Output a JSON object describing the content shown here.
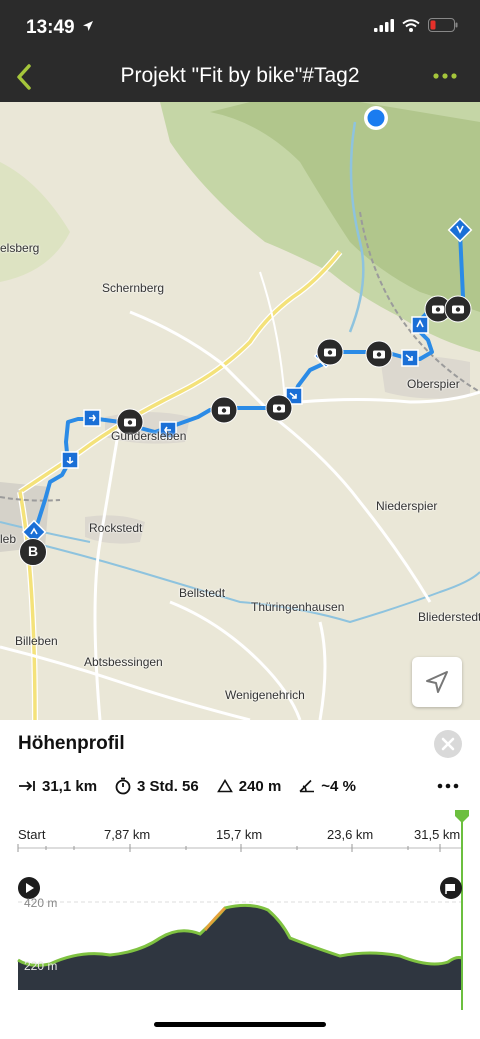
{
  "status": {
    "time": "13:49"
  },
  "nav": {
    "title": "Projekt \"Fit by bike\"#Tag2"
  },
  "map": {
    "labels": {
      "elsberg": "elsberg",
      "schernberg": "Schernberg",
      "oberspier": "Oberspier",
      "gundersleben": "Gundersleben",
      "niederspier": "Niederspier",
      "rockstedt": "Rockstedt",
      "bellstedt": "Bellstedt",
      "thueringenhausen": "Thüringenhausen",
      "bliederstedt": "Bliederstedt",
      "billeben": "Billeben",
      "abtsbessingen": "Abtsbessingen",
      "wenigenehrich": "Wenigenehrich",
      "ebleben_partial": "leb"
    },
    "end_marker": "B"
  },
  "profile": {
    "title": "Höhenprofil",
    "stats": {
      "distance": "31,1 km",
      "duration": "3 Std. 56",
      "ascent": "240 m",
      "gradient": "~4 %"
    },
    "km_ticks": [
      "Start",
      "7,87 km",
      "15,7 km",
      "23,6 km",
      "31,5 km"
    ],
    "altitude_ticks": [
      "420 m",
      "220 m"
    ],
    "colors": {
      "route": "#2b8be6",
      "profile_line": "#7fc241",
      "profile_fill": "#2f3640",
      "accent": "#a5c63b"
    }
  }
}
